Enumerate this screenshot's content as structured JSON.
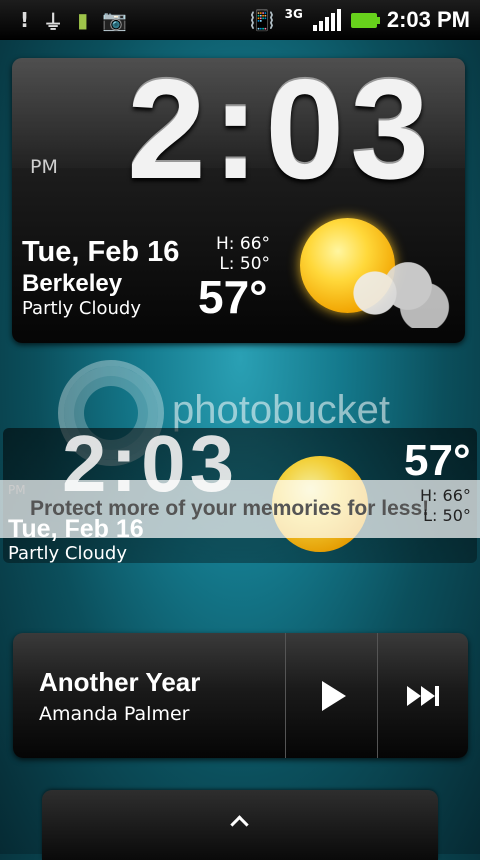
{
  "status_bar": {
    "left_icons": [
      "alert-icon",
      "usb-icon",
      "phone-storage-icon",
      "camera-icon"
    ],
    "right_icons": [
      "vibrate-icon",
      "3g-icon",
      "signal-icon",
      "battery-icon"
    ],
    "network_label": "3G",
    "time": "2:03 PM"
  },
  "clock_widget": {
    "time": "2:03",
    "ampm": "PM",
    "date": "Tue, Feb 16",
    "city": "Berkeley",
    "condition": "Partly Cloudy",
    "high": "H:  66°",
    "low": "L:  50°",
    "temp": "57°",
    "weather_icon": "partly-cloudy-icon",
    "colors": {
      "sun": "#ffd83a",
      "panel": "#1c1c1c"
    }
  },
  "watermark": {
    "text": "photobucket",
    "subtext": "Protect more of your memories for less!"
  },
  "ghost_widget": {
    "time": "2:03",
    "ampm": "PM",
    "date": "Tue, Feb 16",
    "condition": "Partly Cloudy",
    "temp": "57°",
    "high": "H:  66°",
    "low": "L:  50°"
  },
  "music_widget": {
    "song": "Another Year",
    "artist": "Amanda Palmer",
    "play_icon": "play-icon",
    "next_icon": "next-track-icon"
  },
  "app_drawer": {
    "icon": "chevron-up-icon"
  }
}
